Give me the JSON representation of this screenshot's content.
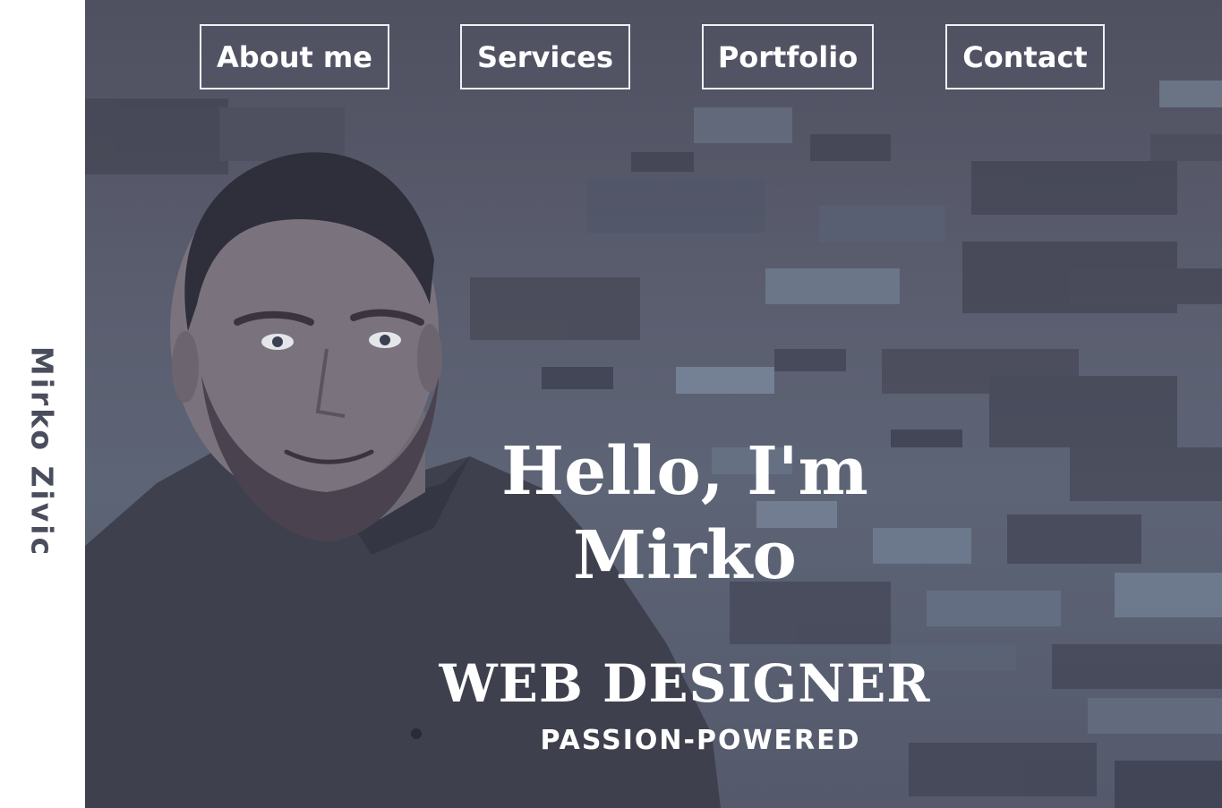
{
  "sidebar": {
    "name": "Mirko Zivic"
  },
  "nav": {
    "items": [
      {
        "label": "About me"
      },
      {
        "label": "Services"
      },
      {
        "label": "Portfolio"
      },
      {
        "label": "Contact"
      }
    ]
  },
  "hero": {
    "greeting": "Hello, I'm Mirko",
    "role": "WEB DESIGNER",
    "tagline": "PASSION-POWERED",
    "photo": "portrait-photo"
  },
  "colors": {
    "accent": "#ffffff",
    "background": "#575b6c",
    "sidebar_text": "#4a4d5c"
  }
}
